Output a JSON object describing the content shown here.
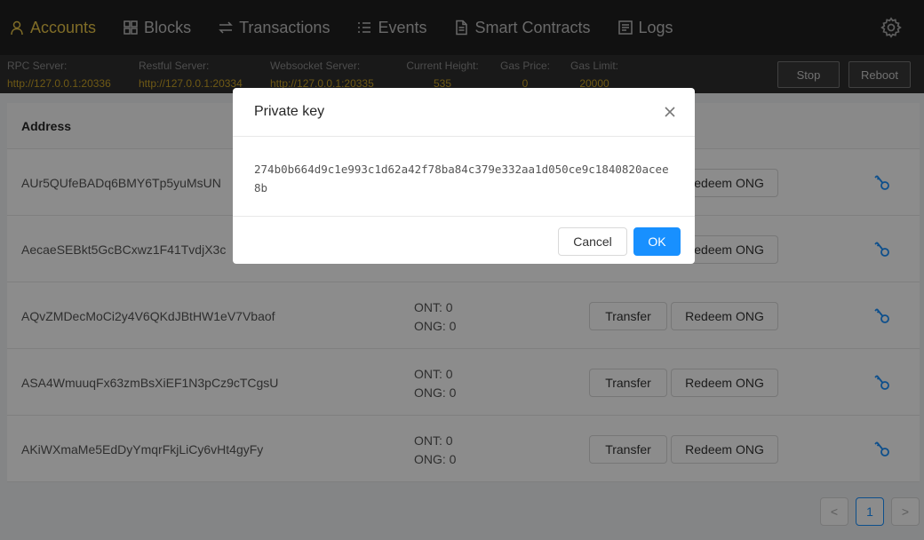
{
  "nav": {
    "items": [
      {
        "label": "Accounts",
        "icon": "user-icon",
        "active": true
      },
      {
        "label": "Blocks",
        "icon": "grid-icon"
      },
      {
        "label": "Transactions",
        "icon": "swap-icon"
      },
      {
        "label": "Events",
        "icon": "list-icon"
      },
      {
        "label": "Smart Contracts",
        "icon": "file-icon"
      },
      {
        "label": "Logs",
        "icon": "log-icon"
      }
    ],
    "settings_icon": "gear-icon"
  },
  "info": {
    "rpc": {
      "label": "RPC Server:",
      "value": "http://127.0.0.1:20336"
    },
    "restful": {
      "label": "Restful Server:",
      "value": "http://127.0.0.1:20334"
    },
    "websocket": {
      "label": "Websocket Server:",
      "value": "http://127.0.0.1:20335"
    },
    "height": {
      "label": "Current Height:",
      "value": "535"
    },
    "gas_price": {
      "label": "Gas Price:",
      "value": "0"
    },
    "gas_limit": {
      "label": "Gas Limit:",
      "value": "20000"
    },
    "stop_label": "Stop",
    "reboot_label": "Reboot"
  },
  "table": {
    "address_header": "Address",
    "transfer_label": "Transfer",
    "redeem_label": "Redeem ONG",
    "rows": [
      {
        "address": "AUr5QUfeBADq6BMY6Tp5yuMsUN",
        "ont": "",
        "ong": ""
      },
      {
        "address": "AecaeSEBkt5GcBCxwz1F41TvdjX3c",
        "ont": "",
        "ong": ""
      },
      {
        "address": "AQvZMDecMoCi2y4V6QKdJBtHW1eV7Vbaof",
        "ont": "ONT: 0",
        "ong": "ONG: 0"
      },
      {
        "address": "ASA4WmuuqFx63zmBsXiEF1N3pCz9cTCgsU",
        "ont": "ONT: 0",
        "ong": "ONG: 0"
      },
      {
        "address": "AKiWXmaMe5EdDyYmqrFkjLiCy6vHt4gyFy",
        "ont": "ONT: 0",
        "ong": "ONG: 0"
      }
    ]
  },
  "pagination": {
    "prev": "<",
    "current": "1",
    "next": ">"
  },
  "modal": {
    "title": "Private key",
    "key": "274b0b664d9c1e993c1d62a42f78ba84c379e332aa1d050ce9c1840820acee8b",
    "cancel_label": "Cancel",
    "ok_label": "OK"
  },
  "colors": {
    "accent": "#1890ff",
    "active_nav": "#e8c547",
    "info_value": "#c9a227"
  }
}
